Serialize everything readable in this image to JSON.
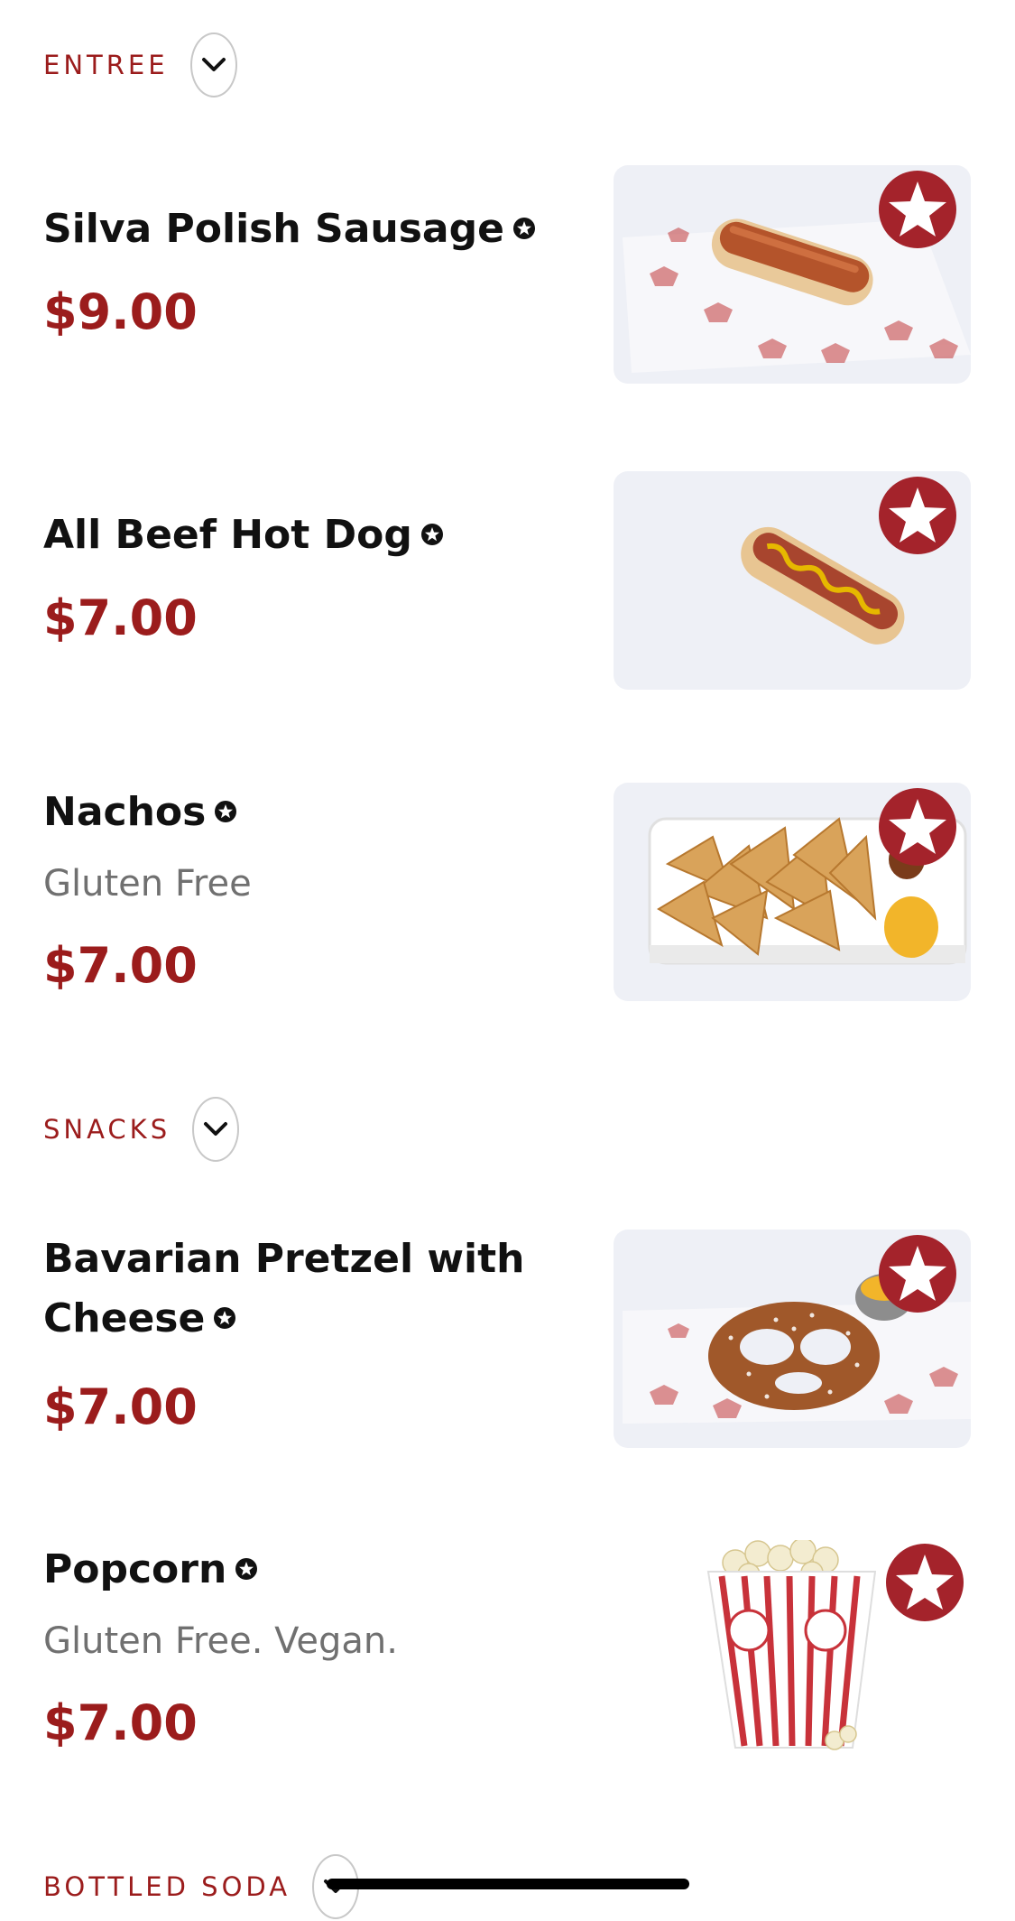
{
  "sections": {
    "entree": {
      "label": "ENTREE"
    },
    "snacks": {
      "label": "SNACKS"
    },
    "bottled_soda": {
      "label": "BOTTLED SODA"
    }
  },
  "items": [
    {
      "name": "Silva Polish Sausage",
      "description": "",
      "price": "$9.00",
      "image": "polish-sausage-photo"
    },
    {
      "name": "All Beef Hot Dog",
      "description": "",
      "price": "$7.00",
      "image": "hot-dog-photo"
    },
    {
      "name": "Nachos",
      "description": "Gluten Free",
      "price": "$7.00",
      "image": "nachos-photo"
    },
    {
      "name_line1": "Bavarian Pretzel with",
      "name_line2": "Cheese",
      "description": "",
      "price": "$7.00",
      "image": "pretzel-photo"
    },
    {
      "name": "Popcorn",
      "description": "Gluten Free. Vegan.",
      "price": "$7.00",
      "image": "popcorn-photo"
    }
  ],
  "icons": {
    "favorite": "star-badge-icon",
    "item_marker": "star-circle-icon",
    "expand": "chevron-down-icon"
  },
  "colors": {
    "accent": "#9b1c1c",
    "text": "#111111",
    "muted": "#707070",
    "badge": "#a4232b"
  }
}
